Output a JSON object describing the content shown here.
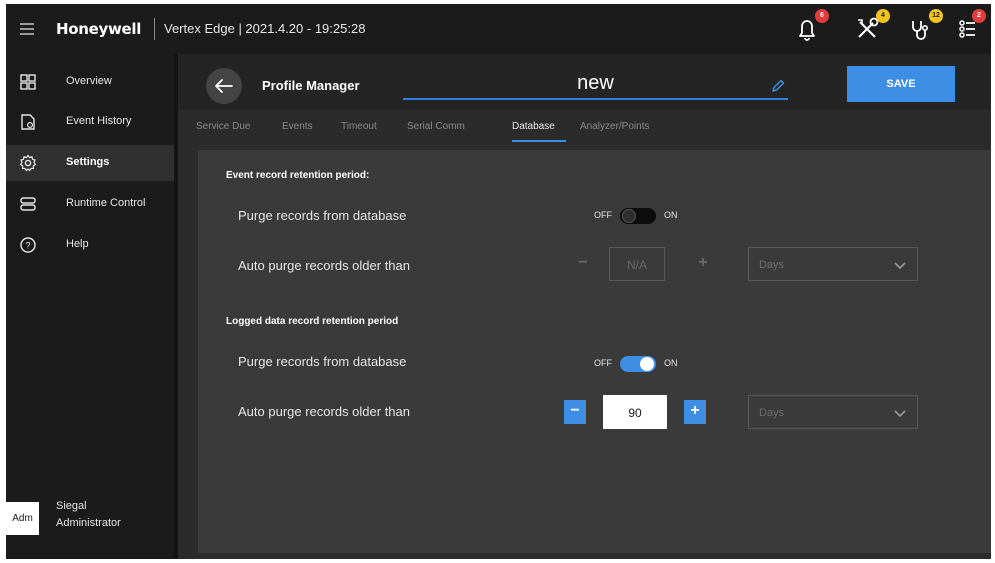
{
  "topbar": {
    "brand": "Honeywell",
    "device_info": "Vertex Edge | 2021.4.20 - 19:25:28",
    "badges": {
      "alarms": "6",
      "maintenance": "4",
      "faults": "12",
      "events": "2"
    },
    "colors": {
      "red_badge": "#e23b3b",
      "yellow_badge": "#f2c318"
    }
  },
  "sidebar": {
    "items": [
      {
        "label": "Overview",
        "icon": "grid-icon"
      },
      {
        "label": "Event History",
        "icon": "document-icon"
      },
      {
        "label": "Settings",
        "icon": "gear-icon",
        "active": true
      },
      {
        "label": "Runtime Control",
        "icon": "server-icon"
      },
      {
        "label": "Help",
        "icon": "help-icon"
      }
    ],
    "user": {
      "avatar": "Adm",
      "name": "Siegal",
      "role": "Administrator"
    }
  },
  "header": {
    "title": "Profile Manager",
    "profile_name": "new",
    "save_label": "SAVE"
  },
  "tabs": [
    {
      "label": "Service Due"
    },
    {
      "label": "Events"
    },
    {
      "label": "Timeout"
    },
    {
      "label": "Serial Comm"
    },
    {
      "label": "Database",
      "active": true
    },
    {
      "label": "Analyzer/Points"
    }
  ],
  "event_section": {
    "title": "Event record retention period:",
    "purge_label": "Purge records from database",
    "toggle": {
      "off": "OFF",
      "on": "ON",
      "state": "off"
    },
    "auto_purge_label": "Auto purge records older than",
    "stepper": {
      "minus": "−",
      "value": "N/A",
      "plus": "+",
      "enabled": false
    },
    "unit": "Days"
  },
  "logged_section": {
    "title": "Logged data record retention period",
    "purge_label": "Purge records from database",
    "toggle": {
      "off": "OFF",
      "on": "ON",
      "state": "on"
    },
    "auto_purge_label": "Auto purge records older than",
    "stepper": {
      "minus": "−",
      "value": "90",
      "plus": "+",
      "enabled": true
    },
    "unit": "Days"
  },
  "accent_color": "#3d8ee4"
}
